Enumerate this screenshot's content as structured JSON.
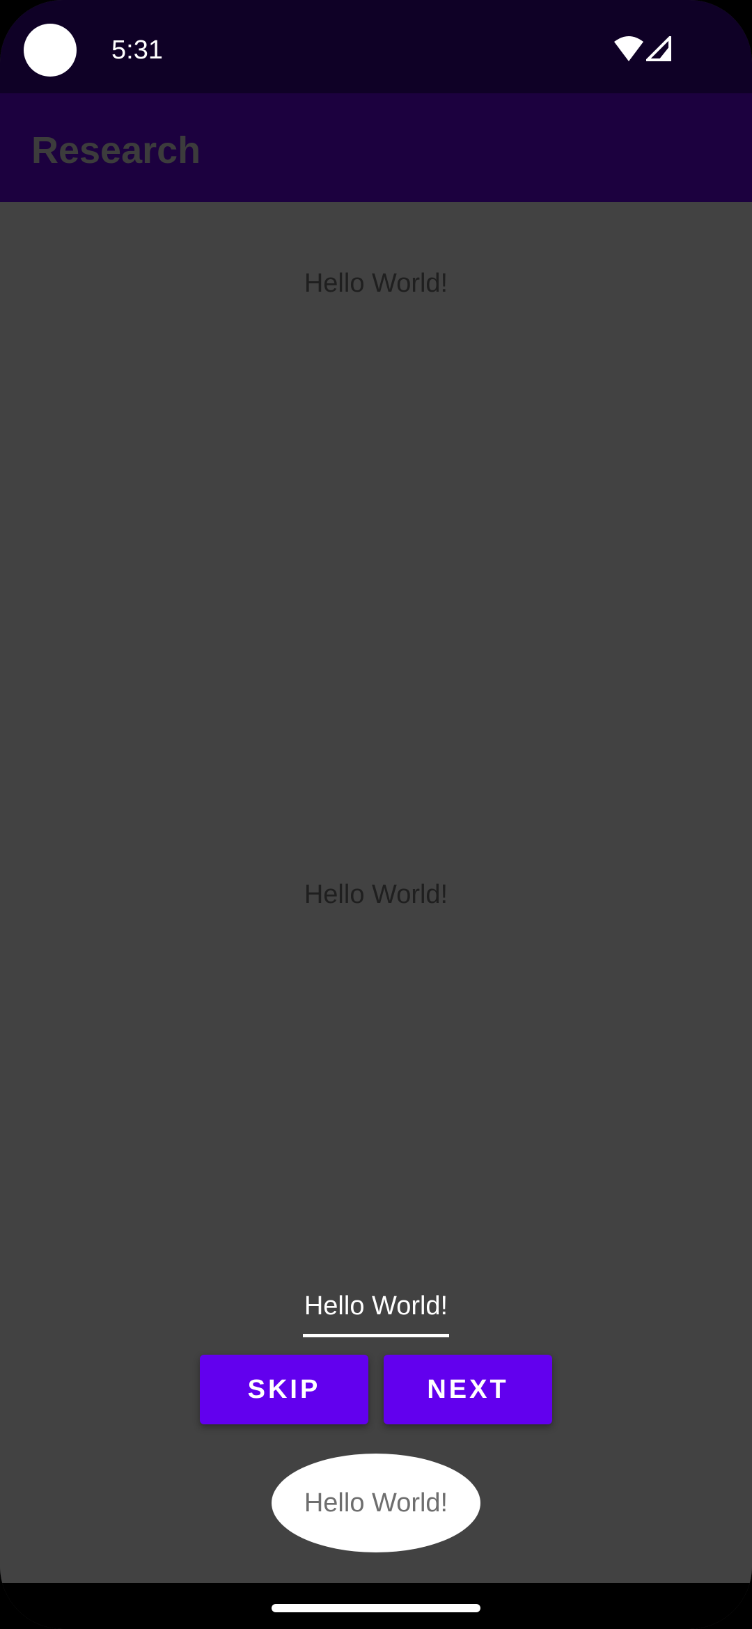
{
  "status_bar": {
    "time": "5:31",
    "icons": [
      "wifi-icon",
      "cell-signal-icon"
    ]
  },
  "app_bar": {
    "title": "Research"
  },
  "main": {
    "text_top": "Hello World!",
    "text_middle": "Hello World!",
    "input_value": "Hello World!",
    "skip_button": "SKIP",
    "next_button": "NEXT",
    "oval_text": "Hello World!"
  },
  "colors": {
    "status_bar_bg": "#0f0126",
    "app_bar_bg": "#1c013f",
    "content_bg": "#424242",
    "button_primary": "#6200ee",
    "text_light": "#ffffff"
  }
}
